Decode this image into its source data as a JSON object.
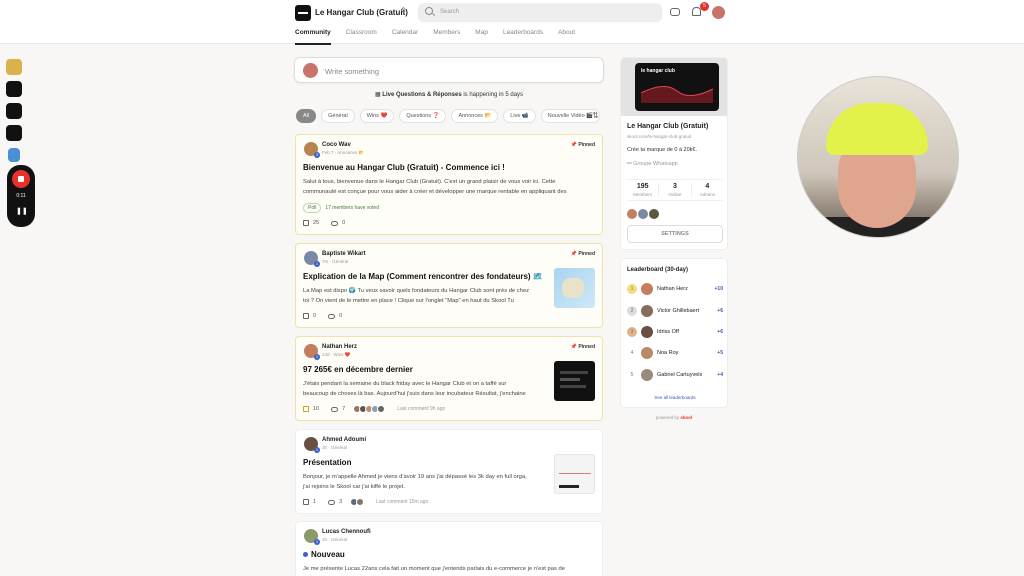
{
  "header": {
    "club_name": "Le Hangar Club (Gratuit)",
    "search_placeholder": "Search",
    "notification_count": "5"
  },
  "nav": {
    "tabs": [
      "Community",
      "Classroom",
      "Calendar",
      "Members",
      "Map",
      "Leaderboards",
      "About"
    ]
  },
  "recorder": {
    "time": "0:11"
  },
  "feed": {
    "write_placeholder": "Write something",
    "live_prefix": "Live Questions & Réponses",
    "live_suffix": " is happening in 5 days",
    "filters": [
      "All",
      "Général",
      "Wins ❤️",
      "Questions ❓",
      "Annonces 📂",
      "Live 📹",
      "Nouvelle Vidéo 🎬"
    ],
    "posts": [
      {
        "author": "Coco Wav",
        "meta": "Feb 7 · Annonces 📂",
        "level": "3",
        "pinned": "Pinned",
        "title": "Bienvenue au Hangar Club (Gratuit) - Commence ici !",
        "body1": "Salut à tous, bienvenue dans le Hangar Club (Gratuit). C'est un grand plaisir de vous voir ici. Cette",
        "body2": "communauté est conçue pour vous aider à créer et développer une marque rentable en appliquant des",
        "poll_label": "Poll",
        "poll_text": "17 members have voted",
        "likes": "25",
        "comments": "0"
      },
      {
        "author": "Baptiste Wikart",
        "meta": "7m · Général",
        "level": "1",
        "pinned": "Pinned",
        "title": "Explication de la Map (Comment rencontrer des fondateurs) 🗺️",
        "body1": "La Map est dispo 🌍 Tu veux savoir quels fondateurs du Hangar Club sont près de chez",
        "body2": "toi ? On vient de le mettre en place ! Clique sur l'onglet \"Map\" en haut du Skool Tu",
        "likes": "0",
        "comments": "0"
      },
      {
        "author": "Nathan Herz",
        "meta": "14d · Wins ❤️",
        "level": "1",
        "pinned": "Pinned",
        "title": "97 265€ en décembre dernier",
        "body1": "J'étais pendant la semaine du black friday avec le Hangar Club et on a taffé sur",
        "body2": "beaucoup de choses là bas. Aujourd'hui j'suis dans leur incubateur Résultat, j'enchaine",
        "likes": "10",
        "comments": "7",
        "last_comment": "Last comment 9h ago"
      },
      {
        "author": "Ahmed Adoumi",
        "meta": "3h · Général",
        "level": "1",
        "title": "Présentation",
        "body1": "Bonjour, je m'appelle Ahmed je viens d'avoir 19 ans j'ai dépassé les 3k day en full orga,",
        "body2": "j'ai rejoins le Skool car j'ai kiffé le projet.",
        "likes": "1",
        "comments": "3",
        "last_comment": "Last comment 15m ago"
      },
      {
        "author": "Lucas Chennoufi",
        "meta": "1h · Général",
        "level": "1",
        "title": "Nouveau",
        "body1": "Je me présente Lucas 22ans cela fait un moment que j'entends parlais du e-commerce je n'est pas de"
      }
    ]
  },
  "sidebar": {
    "banner_text": "le hangar club",
    "title": "Le Hangar Club (Gratuit)",
    "url": "skool.com/le-hangar-club-gratuit",
    "description": "Crée ta marque de 0 à 20k€.",
    "whatsapp": "Groupe Whatsapp",
    "stats": [
      {
        "value": "195",
        "label": "Members"
      },
      {
        "value": "3",
        "label": "Online"
      },
      {
        "value": "4",
        "label": "Admins"
      }
    ],
    "settings_label": "SETTINGS"
  },
  "leaderboard": {
    "title": "Leaderboard (30-day)",
    "rows": [
      {
        "rank": "1",
        "name": "Nathan Herz",
        "points": "+10"
      },
      {
        "rank": "2",
        "name": "Victor Ghillebaert",
        "points": "+6"
      },
      {
        "rank": "3",
        "name": "Idriss Off",
        "points": "+6"
      },
      {
        "rank": "4",
        "name": "Noa Roy",
        "points": "+5"
      },
      {
        "rank": "5",
        "name": "Gabriel Cartuyvels",
        "points": "+4"
      }
    ],
    "see_all": "See all leaderboards"
  },
  "footer": {
    "powered_prefix": "powered by ",
    "powered_brand": "skool"
  },
  "colors": {
    "accent": "#3d5fc8",
    "record": "#e5332a",
    "pinned_border": "#f0e2a8"
  }
}
